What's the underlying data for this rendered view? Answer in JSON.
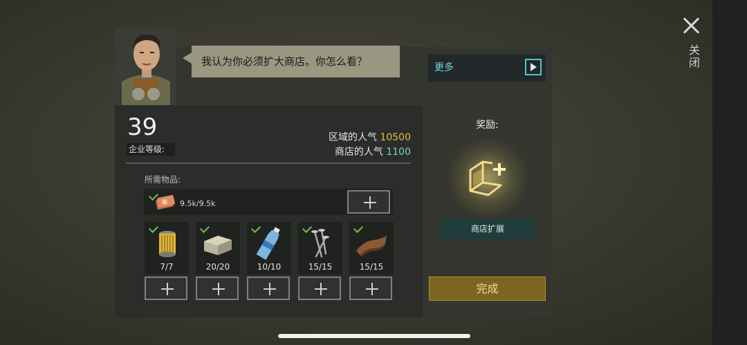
{
  "close": {
    "label": "关闭",
    "icon": "close-icon"
  },
  "dialog": {
    "speech": "我认为你必须扩大商店。你怎么看？",
    "more_label": "更多",
    "more_icon": "play-icon"
  },
  "company": {
    "level": "39",
    "level_label": "企业等级:",
    "area_popularity_label": "区域的人气",
    "area_popularity_value": "10500",
    "shop_popularity_label": "商店的人气",
    "shop_popularity_value": "1100"
  },
  "requirements": {
    "label": "所需物品:",
    "money": {
      "icon": "banknote-icon",
      "amount": "9.5k/9.5k",
      "complete": true
    },
    "items": [
      {
        "icon": "oil-filter-icon",
        "count": "7/7",
        "complete": true
      },
      {
        "icon": "stone-block-icon",
        "count": "20/20",
        "complete": true
      },
      {
        "icon": "water-bottle-icon",
        "count": "10/10",
        "complete": true
      },
      {
        "icon": "nails-icon",
        "count": "15/15",
        "complete": true
      },
      {
        "icon": "leather-icon",
        "count": "15/15",
        "complete": true
      }
    ]
  },
  "reward": {
    "title": "奖励:",
    "icon": "shop-expansion-icon",
    "badge": "商店扩展",
    "complete_button": "完成"
  },
  "colors": {
    "gold": "#e7b94a",
    "cyan": "#6fd3d8",
    "check_green": "#6cc04a",
    "complete_button": "#7b6520"
  }
}
